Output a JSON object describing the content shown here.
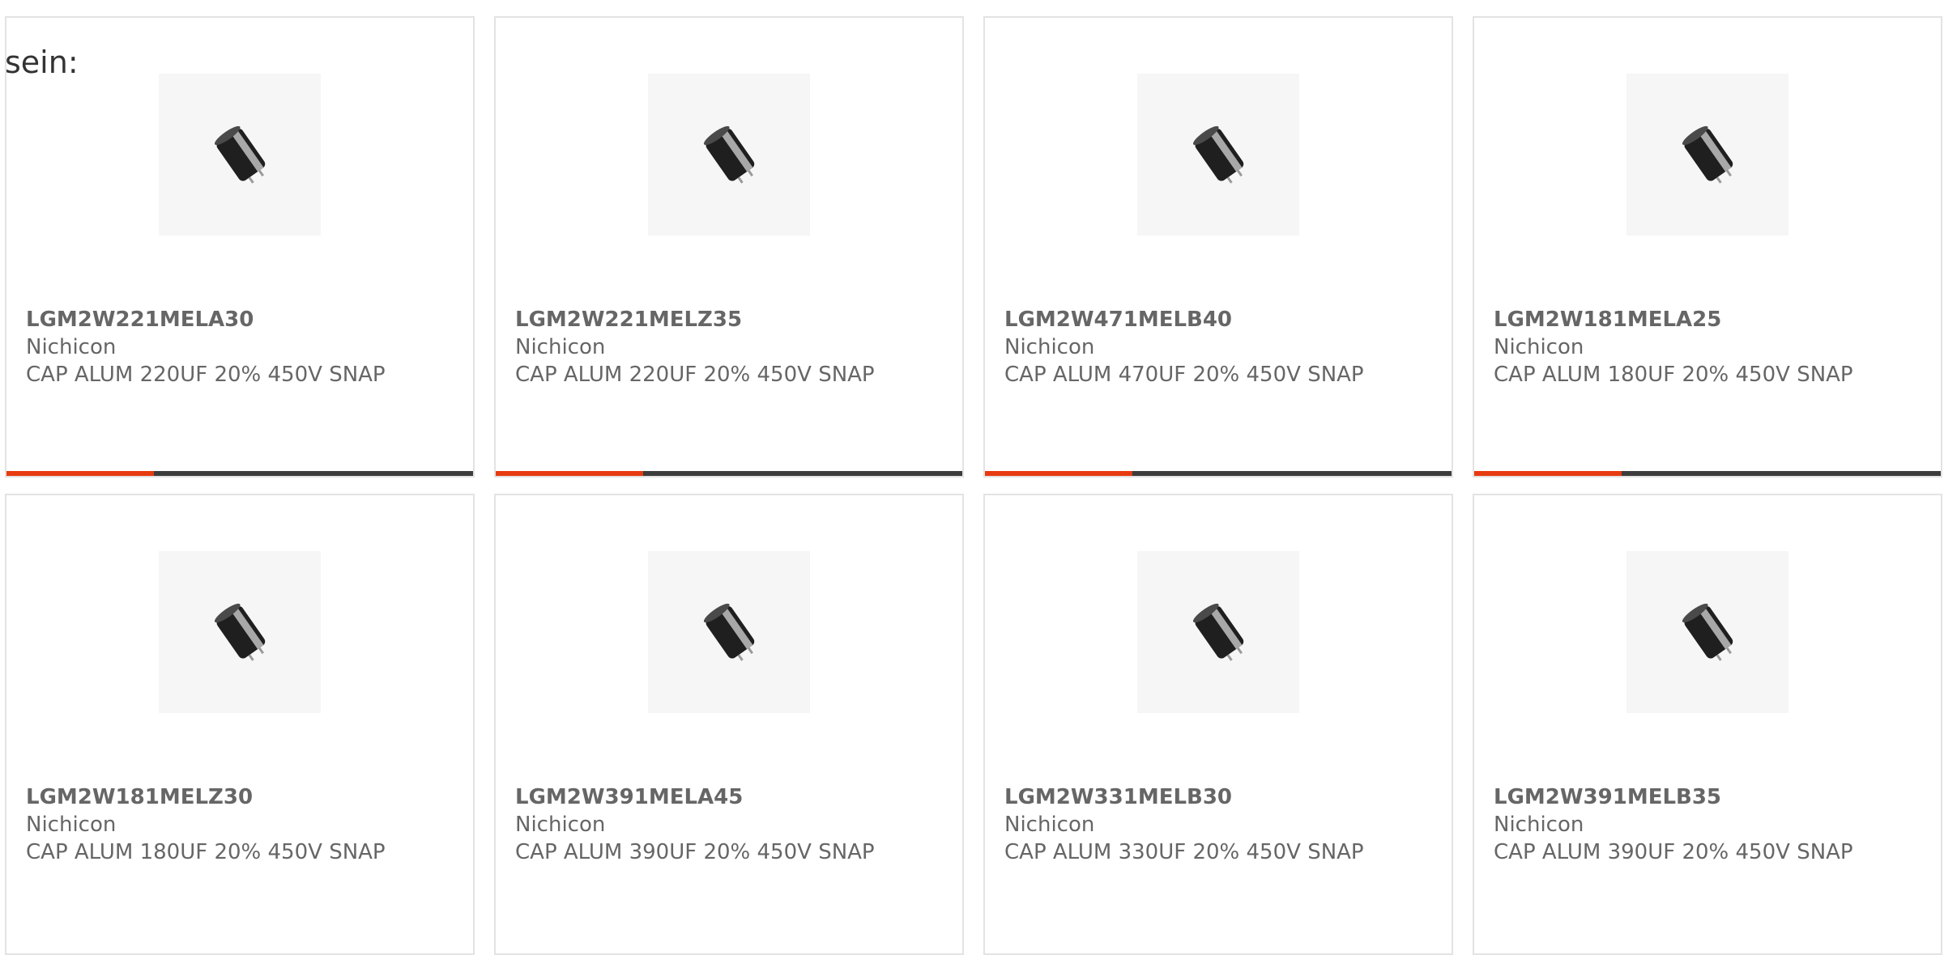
{
  "intro_text": "sein:",
  "colors": {
    "accent": "#e83a10",
    "bar_track": "#3c3c3c",
    "text": "#666666",
    "card_border": "#e3e3e3"
  },
  "products": [
    {
      "part_number": "LGM2W221MELA30",
      "manufacturer": "Nichicon",
      "description": "CAP ALUM 220UF 20% 450V SNAP",
      "image_icon": "capacitor-icon"
    },
    {
      "part_number": "LGM2W221MELZ35",
      "manufacturer": "Nichicon",
      "description": "CAP ALUM 220UF 20% 450V SNAP",
      "image_icon": "capacitor-icon"
    },
    {
      "part_number": "LGM2W471MELB40",
      "manufacturer": "Nichicon",
      "description": "CAP ALUM 470UF 20% 450V SNAP",
      "image_icon": "capacitor-icon"
    },
    {
      "part_number": "LGM2W181MELA25",
      "manufacturer": "Nichicon",
      "description": "CAP ALUM 180UF 20% 450V SNAP",
      "image_icon": "capacitor-icon"
    },
    {
      "part_number": "LGM2W181MELZ30",
      "manufacturer": "Nichicon",
      "description": "CAP ALUM 180UF 20% 450V SNAP",
      "image_icon": "capacitor-icon"
    },
    {
      "part_number": "LGM2W391MELA45",
      "manufacturer": "Nichicon",
      "description": "CAP ALUM 390UF 20% 450V SNAP",
      "image_icon": "capacitor-icon"
    },
    {
      "part_number": "LGM2W331MELB30",
      "manufacturer": "Nichicon",
      "description": "CAP ALUM 330UF 20% 450V SNAP",
      "image_icon": "capacitor-icon"
    },
    {
      "part_number": "LGM2W391MELB35",
      "manufacturer": "Nichicon",
      "description": "CAP ALUM 390UF 20% 450V SNAP",
      "image_icon": "capacitor-icon"
    }
  ]
}
